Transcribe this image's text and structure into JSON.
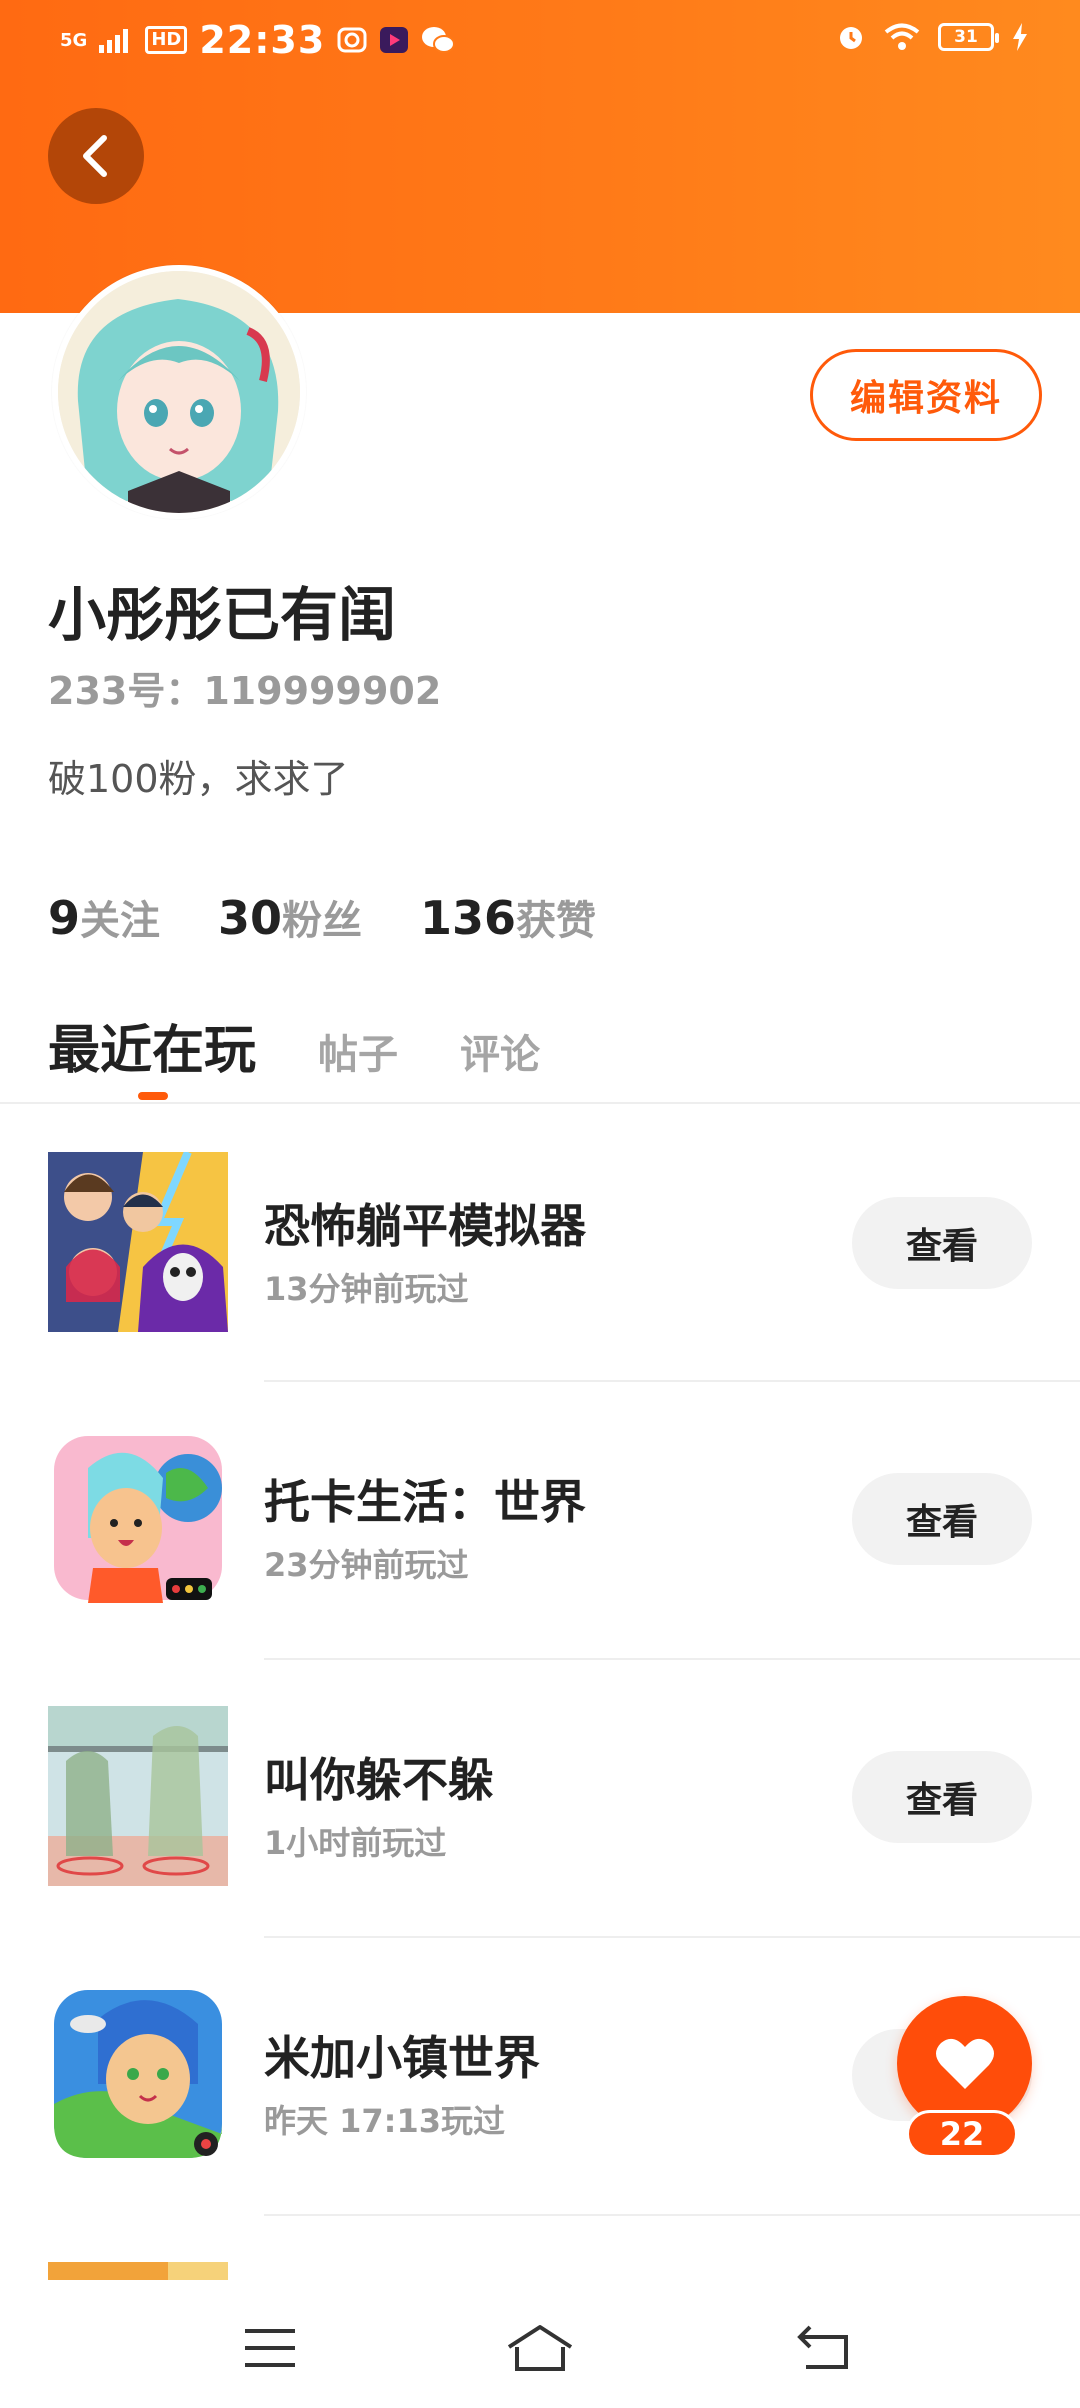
{
  "status_bar": {
    "network": "5G",
    "hd": "HD",
    "time": "22:33",
    "battery": "31"
  },
  "profile": {
    "nickname": "小彤彤已有闺",
    "uid": "233号：119999902",
    "bio": "破100粉，求求了",
    "edit_label": "编辑资料"
  },
  "stats": [
    {
      "value": "9",
      "label": "关注"
    },
    {
      "value": "30",
      "label": "粉丝"
    },
    {
      "value": "136",
      "label": "获赞"
    }
  ],
  "tabs": [
    {
      "label": "最近在玩",
      "active": true
    },
    {
      "label": "帖子",
      "active": false
    },
    {
      "label": "评论",
      "active": false
    }
  ],
  "games": [
    {
      "title": "恐怖躺平模拟器",
      "time": "13分钟前玩过",
      "button": "查看"
    },
    {
      "title": "托卡生活：世界",
      "time": "23分钟前玩过",
      "button": "查看"
    },
    {
      "title": "叫你躲不躲",
      "time": "1小时前玩过",
      "button": "查看"
    },
    {
      "title": "米加小镇世界",
      "time": "昨天 17:13玩过",
      "button": "查看"
    }
  ],
  "like": {
    "count": "22"
  },
  "colors": {
    "accent": "#ff5a0a",
    "header_start": "#ff6a12",
    "header_end": "#ff8a1e"
  }
}
